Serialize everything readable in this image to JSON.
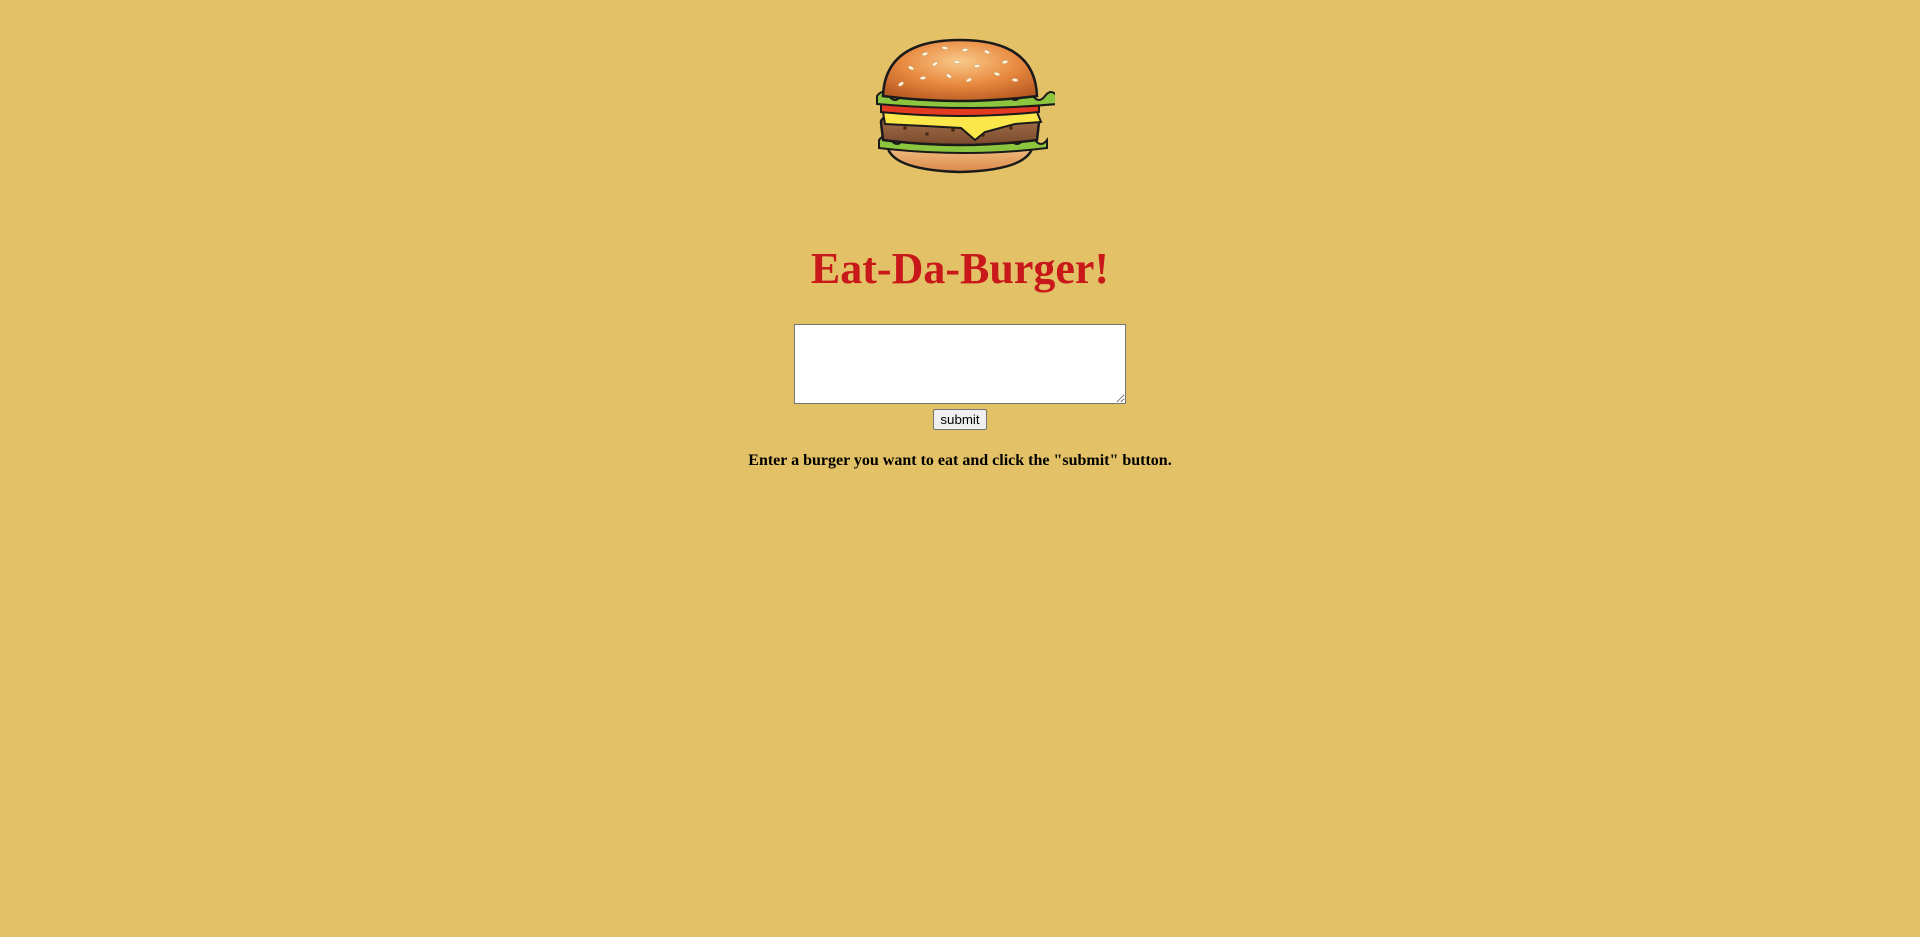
{
  "page": {
    "background_color": "#e3c166"
  },
  "logo": {
    "icon": "burger-icon"
  },
  "header": {
    "title": "Eat-Da-Burger!",
    "title_color": "#c8181a"
  },
  "form": {
    "burger_input_value": "",
    "submit_label": "submit"
  },
  "instructions": {
    "text": "Enter a burger you want to eat and click the \"submit\" button."
  }
}
